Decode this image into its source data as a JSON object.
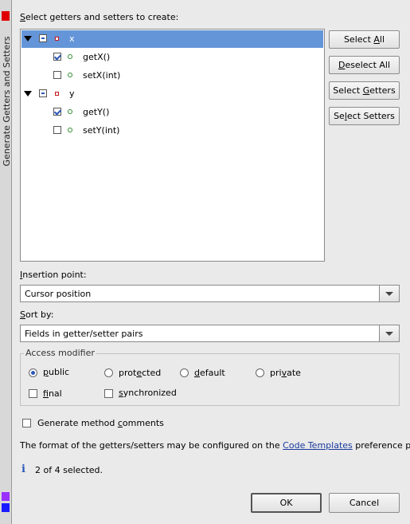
{
  "side_tab": {
    "title": "Generate Getters and Setters",
    "colors": {
      "top": "#e00000",
      "purple": "#9b30ff",
      "blue": "#1a1aff"
    }
  },
  "header": {
    "prompt_pre": "",
    "prompt_u": "S",
    "prompt_post": "elect getters and setters to create:"
  },
  "tree": {
    "rows": [
      {
        "label": "x",
        "kind": "field",
        "state": "partial",
        "selected": true
      },
      {
        "label": "getX()",
        "kind": "method",
        "state": "checked"
      },
      {
        "label": "setX(int)",
        "kind": "method",
        "state": "unchecked"
      },
      {
        "label": "y",
        "kind": "field",
        "state": "partial"
      },
      {
        "label": "getY()",
        "kind": "method",
        "state": "checked"
      },
      {
        "label": "setY(int)",
        "kind": "method",
        "state": "unchecked"
      }
    ]
  },
  "buttons": {
    "select_all": {
      "pre": "Select ",
      "u": "A",
      "post": "ll"
    },
    "deselect_all": {
      "pre": "",
      "u": "D",
      "post": "eselect All"
    },
    "select_getters": {
      "pre": "Select ",
      "u": "G",
      "post": "etters"
    },
    "select_setters": {
      "pre": "Se",
      "u": "l",
      "post": "ect Setters"
    }
  },
  "insertion": {
    "label_u": "I",
    "label_post": "nsertion point:",
    "value": "Cursor position"
  },
  "sort": {
    "label_u": "S",
    "label_post": "ort by:",
    "value": "Fields in getter/setter pairs"
  },
  "access": {
    "legend": "Access modifier",
    "options": {
      "public": {
        "pre": "",
        "u": "p",
        "post": "ublic",
        "on": true
      },
      "protected": {
        "pre": "prot",
        "u": "e",
        "post": "cted"
      },
      "default": {
        "pre": "",
        "u": "d",
        "post": "efault"
      },
      "private": {
        "pre": "pri",
        "u": "v",
        "post": "ate"
      }
    },
    "final": {
      "pre": "",
      "u": "f",
      "post": "inal"
    },
    "synchronized": {
      "pre": "",
      "u": "s",
      "post": "ynchronized"
    }
  },
  "comments": {
    "pre": "Generate method ",
    "u": "c",
    "post": "omments"
  },
  "format": {
    "pre": "The format of the getters/setters may be configured on the ",
    "link": "Code Templates",
    "post": " preference page."
  },
  "status": {
    "icon": "info-icon",
    "text": "2 of 4 selected."
  },
  "footer": {
    "ok": "OK",
    "cancel": "Cancel"
  }
}
